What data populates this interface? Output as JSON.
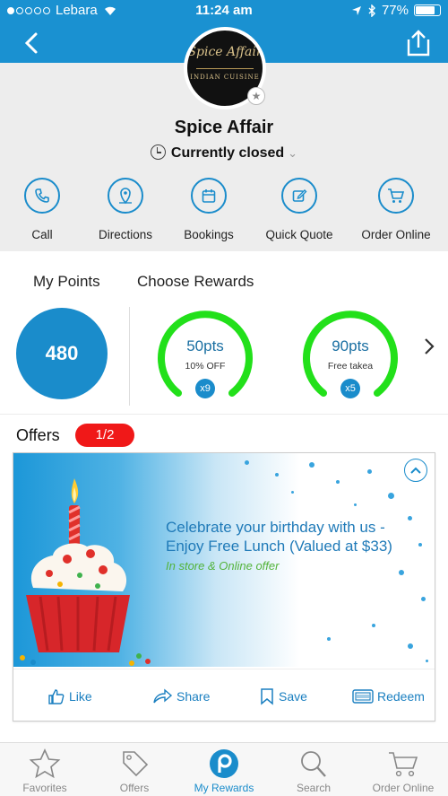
{
  "status_bar": {
    "carrier": "Lebara",
    "time": "11:24 am",
    "battery": "77%"
  },
  "business": {
    "name": "Spice Affair",
    "logo_line1": "Spice Affair",
    "logo_line2": "INDIAN CUISINE",
    "hours_status": "Currently closed"
  },
  "actions": [
    {
      "label": "Call",
      "icon": "phone-icon"
    },
    {
      "label": "Directions",
      "icon": "map-pin-icon"
    },
    {
      "label": "Bookings",
      "icon": "calendar-icon"
    },
    {
      "label": "Quick Quote",
      "icon": "edit-icon"
    },
    {
      "label": "Order Online",
      "icon": "cart-icon"
    }
  ],
  "points": {
    "my_points_label": "My Points",
    "choose_rewards_label": "Choose Rewards",
    "value": "480"
  },
  "rewards": [
    {
      "points": "50pts",
      "description": "10% OFF",
      "count": "x9"
    },
    {
      "points": "90pts",
      "description": "Free takea",
      "count": "x5"
    }
  ],
  "offers": {
    "label": "Offers",
    "pager": "1/2",
    "title": "Celebrate your birthday with us - Enjoy Free Lunch (Valued at $33)",
    "subtitle": "In store & Online offer",
    "buttons": {
      "like": "Like",
      "share": "Share",
      "save": "Save",
      "redeem": "Redeem"
    }
  },
  "tabs": [
    {
      "label": "Favorites",
      "icon": "star-icon",
      "active": false
    },
    {
      "label": "Offers",
      "icon": "tag-icon",
      "active": false
    },
    {
      "label": "My Rewards",
      "icon": "rewards-logo-icon",
      "active": true
    },
    {
      "label": "Search",
      "icon": "search-icon",
      "active": false
    },
    {
      "label": "Order Online",
      "icon": "cart-icon",
      "active": false
    }
  ],
  "colors": {
    "primary": "#1a91d1",
    "ring_green": "#22e01a",
    "badge_red": "#f01818",
    "offer_green": "#53b33a"
  }
}
